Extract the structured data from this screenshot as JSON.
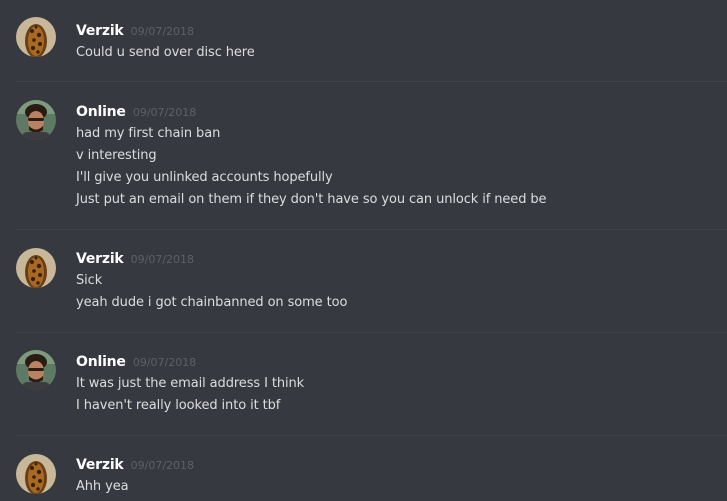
{
  "messages": [
    {
      "username": "Verzik",
      "timestamp": "09/07/2018",
      "avatar": "leopard-avatar",
      "lines": [
        "Could u send over disc here"
      ]
    },
    {
      "username": "Online",
      "timestamp": "09/07/2018",
      "avatar": "person-avatar",
      "lines": [
        "had my first chain ban",
        "v interesting",
        "I'll give you unlinked accounts hopefully",
        "Just put an email on them if they don't have so you can unlock if need be"
      ]
    },
    {
      "username": "Verzik",
      "timestamp": "09/07/2018",
      "avatar": "leopard-avatar",
      "lines": [
        "Sick",
        "yeah dude i got chainbanned on some too"
      ]
    },
    {
      "username": "Online",
      "timestamp": "09/07/2018",
      "avatar": "person-avatar",
      "lines": [
        "It was just the email address I think",
        "I haven't really looked into it tbf"
      ]
    },
    {
      "username": "Verzik",
      "timestamp": "09/07/2018",
      "avatar": "leopard-avatar",
      "lines": [
        "Ahh yea"
      ]
    }
  ],
  "colors": {
    "background": "#36393f",
    "username": "#ffffff",
    "timestamp": "#5d6067",
    "message_text": "#dcddde",
    "divider": "#40434a"
  }
}
